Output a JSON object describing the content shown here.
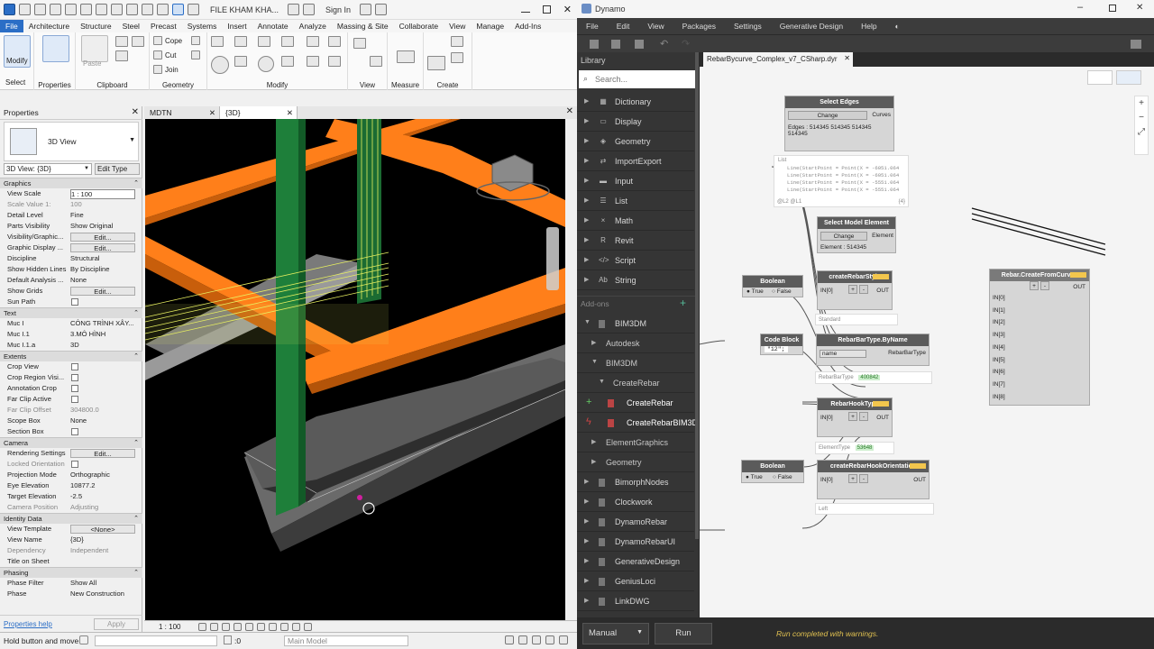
{
  "revit": {
    "file_title": "FILE KHAM KHA...",
    "sign_in": "Sign In",
    "tabs": [
      "File",
      "Architecture",
      "Structure",
      "Steel",
      "Precast",
      "Systems",
      "Insert",
      "Annotate",
      "Analyze",
      "Massing & Site",
      "Collaborate",
      "View",
      "Manage",
      "Add-Ins"
    ],
    "ribbon": {
      "modify": "Modify",
      "select": "Select",
      "properties": "Properties",
      "paste": "Paste",
      "clipboard": "Clipboard",
      "cope": "Cope",
      "cut": "Cut",
      "join": "Join",
      "geometry": "Geometry",
      "modify_group": "Modify",
      "view": "View",
      "measure": "Measure",
      "create": "Create"
    },
    "properties": {
      "title": "Properties",
      "type_name": "3D View",
      "view_selector": "3D View: {3D}",
      "edit_type": "Edit Type",
      "help_link": "Properties help",
      "apply": "Apply",
      "rows": [
        {
          "k": "Graphics",
          "sec": true
        },
        {
          "k": "View Scale",
          "v": "1 : 100",
          "input": true
        },
        {
          "k": "Scale Value    1:",
          "v": "100",
          "gray": true
        },
        {
          "k": "Detail Level",
          "v": "Fine"
        },
        {
          "k": "Parts Visibility",
          "v": "Show Original"
        },
        {
          "k": "Visibility/Graphic...",
          "v": "Edit...",
          "btn": true
        },
        {
          "k": "Graphic Display ...",
          "v": "Edit...",
          "btn": true
        },
        {
          "k": "Discipline",
          "v": "Structural"
        },
        {
          "k": "Show Hidden Lines",
          "v": "By Discipline"
        },
        {
          "k": "Default Analysis ...",
          "v": "None"
        },
        {
          "k": "Show Grids",
          "v": "Edit...",
          "btn": true
        },
        {
          "k": "Sun Path",
          "chk": true
        },
        {
          "k": "Text",
          "sec": true
        },
        {
          "k": "Muc I",
          "v": "CÔNG TRÌNH XÂY..."
        },
        {
          "k": "Muc I.1",
          "v": "3.MÔ HÌNH"
        },
        {
          "k": "Muc I.1.a",
          "v": "3D"
        },
        {
          "k": "Extents",
          "sec": true
        },
        {
          "k": "Crop View",
          "chk": true
        },
        {
          "k": "Crop Region Visi...",
          "chk": true
        },
        {
          "k": "Annotation Crop",
          "chk": true
        },
        {
          "k": "Far Clip Active",
          "chk": true
        },
        {
          "k": "Far Clip Offset",
          "v": "304800.0",
          "gray": true
        },
        {
          "k": "Scope Box",
          "v": "None"
        },
        {
          "k": "Section Box",
          "chk": true
        },
        {
          "k": "Camera",
          "sec": true
        },
        {
          "k": "Rendering Settings",
          "v": "Edit...",
          "btn": true
        },
        {
          "k": "Locked Orientation",
          "chk": true,
          "gray": true
        },
        {
          "k": "Projection Mode",
          "v": "Orthographic"
        },
        {
          "k": "Eye Elevation",
          "v": "10877.2"
        },
        {
          "k": "Target Elevation",
          "v": "-2.5"
        },
        {
          "k": "Camera Position",
          "v": "Adjusting",
          "gray": true
        },
        {
          "k": "Identity Data",
          "sec": true
        },
        {
          "k": "View Template",
          "v": "<None>",
          "btn": true
        },
        {
          "k": "View Name",
          "v": "{3D}"
        },
        {
          "k": "Dependency",
          "v": "Independent",
          "gray": true
        },
        {
          "k": "Title on Sheet",
          "v": ""
        },
        {
          "k": "Phasing",
          "sec": true
        },
        {
          "k": "Phase Filter",
          "v": "Show All"
        },
        {
          "k": "Phase",
          "v": "New Construction"
        }
      ]
    },
    "view_tabs": [
      "MDTN",
      "{3D}"
    ],
    "view_scale": "1 : 100",
    "status_text": "Hold button and move",
    "status_zero": ":0",
    "main_model": "Main Model"
  },
  "dynamo": {
    "title": "Dynamo",
    "menu": [
      "File",
      "Edit",
      "View",
      "Packages",
      "Settings",
      "Generative Design",
      "Help"
    ],
    "library_label": "Library",
    "search_placeholder": "Search...",
    "file_tab": "RebarBycurve_Complex_v7_CSharp.dyr",
    "add_ons_label": "Add-ons",
    "library_items": [
      {
        "t": "Dictionary",
        "ico": "▦"
      },
      {
        "t": "Display",
        "ico": "▭"
      },
      {
        "t": "Geometry",
        "ico": "◈"
      },
      {
        "t": "ImportExport",
        "ico": "⇄"
      },
      {
        "t": "Input",
        "ico": "▬"
      },
      {
        "t": "List",
        "ico": "☰"
      },
      {
        "t": "Math",
        "ico": "×"
      },
      {
        "t": "Revit",
        "ico": "R"
      },
      {
        "t": "Script",
        "ico": "</>"
      },
      {
        "t": "String",
        "ico": "Ab"
      }
    ],
    "addon_items": [
      {
        "t": "BIM3DM",
        "indent": 0,
        "open": true
      },
      {
        "t": "Autodesk",
        "indent": 1
      },
      {
        "t": "BIM3DM",
        "indent": 1,
        "open": true
      },
      {
        "t": "CreateRebar",
        "indent": 2,
        "open": true
      },
      {
        "t": "CreateRebar",
        "indent": 3,
        "node": true
      },
      {
        "t": "CreateRebarBIM3D",
        "indent": 3,
        "node": true
      },
      {
        "t": "ElementGraphics",
        "indent": 1
      },
      {
        "t": "Geometry",
        "indent": 1
      },
      {
        "t": "BimorphNodes",
        "indent": 0
      },
      {
        "t": "Clockwork",
        "indent": 0
      },
      {
        "t": "DynamoRebar",
        "indent": 0
      },
      {
        "t": "DynamoRebarUI",
        "indent": 0
      },
      {
        "t": "GenerativeDesign",
        "indent": 0
      },
      {
        "t": "GeniusLoci",
        "indent": 0
      },
      {
        "t": "LinkDWG",
        "indent": 0
      }
    ],
    "run_mode": "Manual",
    "run_button": "Run",
    "run_status": "Run completed with warnings.",
    "nodes": {
      "select_edges": {
        "title": "Select Edges",
        "change": "Change",
        "out": "Curves",
        "text": "Edges : 514345 514345 514345 514345"
      },
      "list_preview": {
        "head": "List",
        "lines": [
          "Line(StartPoint = Point(X = -6051.064",
          "Line(StartPoint = Point(X = -6051.064",
          "Line(StartPoint = Point(X = -5551.064",
          "Line(StartPoint = Point(X = -5551.064"
        ],
        "foot_left": "@L2 @L1",
        "foot_right": "{4}"
      },
      "select_model_element": {
        "title": "Select Model Element",
        "change": "Change",
        "out": "Element",
        "text": "Element : 514345"
      },
      "boolean1": {
        "title": "Boolean",
        "true": "True",
        "false": "False"
      },
      "create_rebar_style": {
        "title": "createRebarStyle",
        "in": "IN[0]",
        "out": "OUT",
        "preview": "Standard"
      },
      "code_block": {
        "title": "Code Block",
        "code": "\"12\";"
      },
      "rebar_bar_type": {
        "title": "RebarBarType.ByName",
        "in": "name",
        "out": "RebarBarType",
        "preview": "RebarBarType",
        "id": "400842"
      },
      "rebar_hook_type": {
        "title": "RebarHookType",
        "in": "IN[0]",
        "out": "OUT",
        "preview": "ElementType",
        "id": "53648"
      },
      "boolean2": {
        "title": "Boolean",
        "true": "True",
        "false": "False"
      },
      "hook_orientation": {
        "title": "createRebarHookOrientation",
        "in": "IN[0]",
        "out": "OUT",
        "preview": "Left"
      },
      "create_from_curves": {
        "title": "Rebar.CreateFromCurves",
        "ins": [
          "IN[0]",
          "IN[1]",
          "IN[2]",
          "IN[3]",
          "IN[4]",
          "IN[5]",
          "IN[6]",
          "IN[7]",
          "IN[8]"
        ],
        "out": "OUT"
      }
    }
  },
  "colors": {
    "revit_active_tab": "#2b6ec6",
    "beam_orange": "#ff7f1a",
    "column_green": "#1e7f3a",
    "rebar_yellow": "#e8f060",
    "dynamo_dark": "#2b2b2b",
    "canvas": "#f4f4f4"
  }
}
